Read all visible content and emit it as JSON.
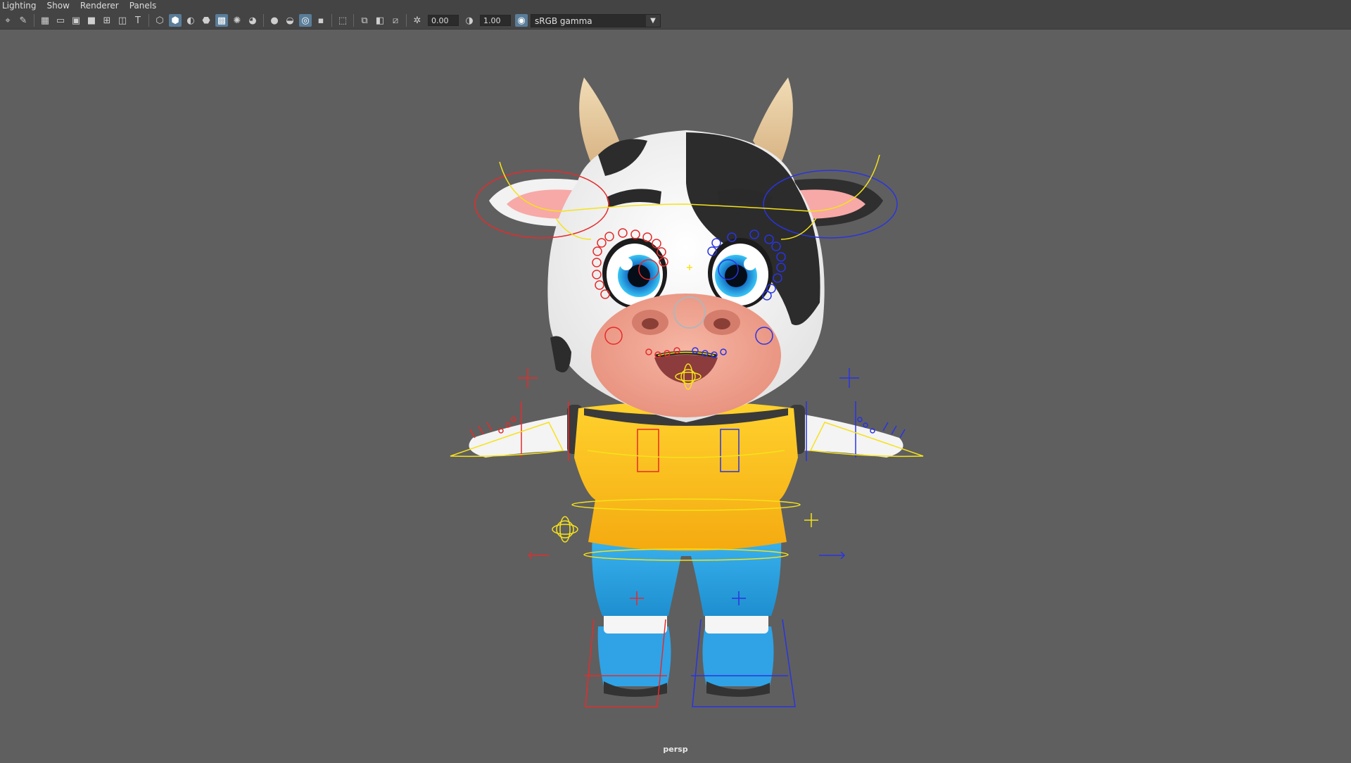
{
  "menu": [
    "Lighting",
    "Show",
    "Renderer",
    "Panels"
  ],
  "toolbar": {
    "exposure_value": "0.00",
    "gamma_value": "1.00",
    "color_space": "sRGB gamma",
    "icons": [
      "select-camera-icon",
      "camera-attributes-icon",
      "grid-icon",
      "film-gate-icon",
      "resolution-gate-icon",
      "gate-mask-icon",
      "field-chart-icon",
      "safe-action-icon",
      "safe-title-icon",
      "wireframe-icon",
      "smooth-shade-icon",
      "default-material-icon",
      "wireframe-on-shaded-icon",
      "xray-icon",
      "use-lights-icon",
      "shadows-icon",
      "screen-space-ao-icon",
      "motion-blur-icon",
      "anti-aliasing-icon",
      "depth-of-field-icon",
      "isolate-select-icon",
      "xray-joints-icon",
      "xray-active-icon",
      "exposure-icon",
      "gamma-icon",
      "color-management-icon"
    ]
  },
  "viewport": {
    "camera_name": "persp",
    "background_color": "#5f5f5f"
  }
}
